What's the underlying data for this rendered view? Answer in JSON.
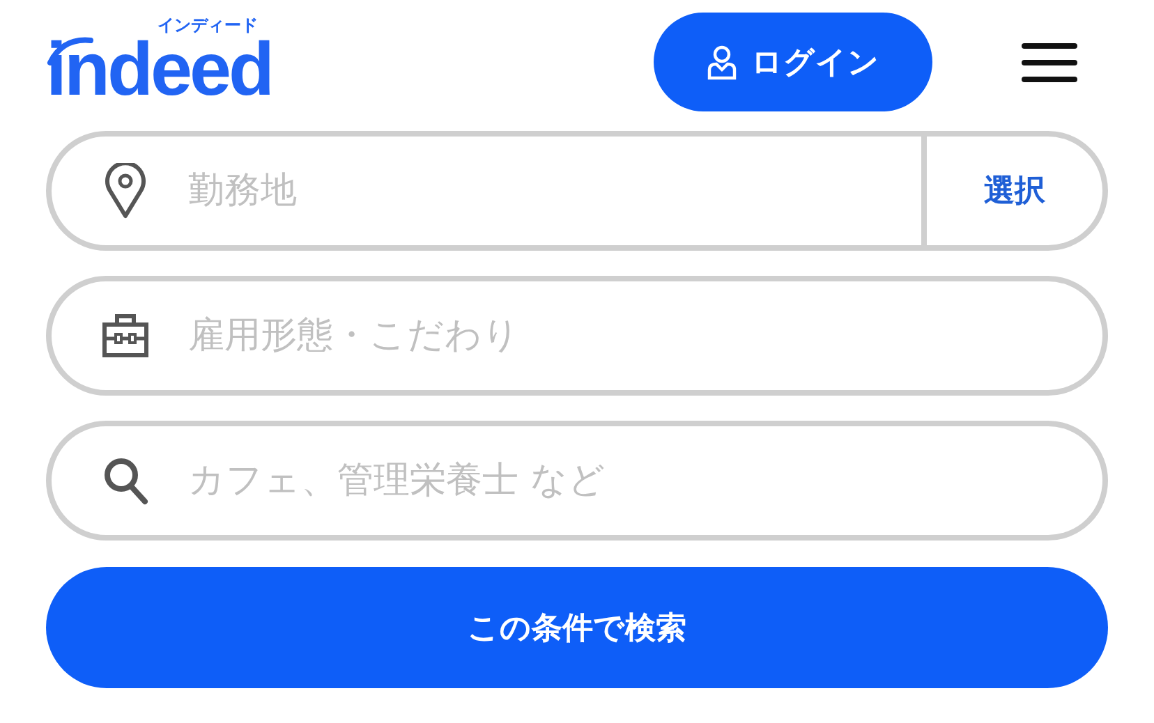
{
  "header": {
    "logo": {
      "wordmark": "indeed",
      "kana": "インディード"
    },
    "login_button": {
      "label": "ログイン"
    }
  },
  "search_fields": [
    {
      "kind": "location",
      "placeholder": "勤務地",
      "action": "選択"
    },
    {
      "kind": "employment",
      "placeholder": "雇用形態・こだわり"
    },
    {
      "kind": "keyword",
      "placeholder": "カフェ、管理栄養士 など"
    }
  ],
  "search_button": {
    "label": "この条件で検索"
  }
}
